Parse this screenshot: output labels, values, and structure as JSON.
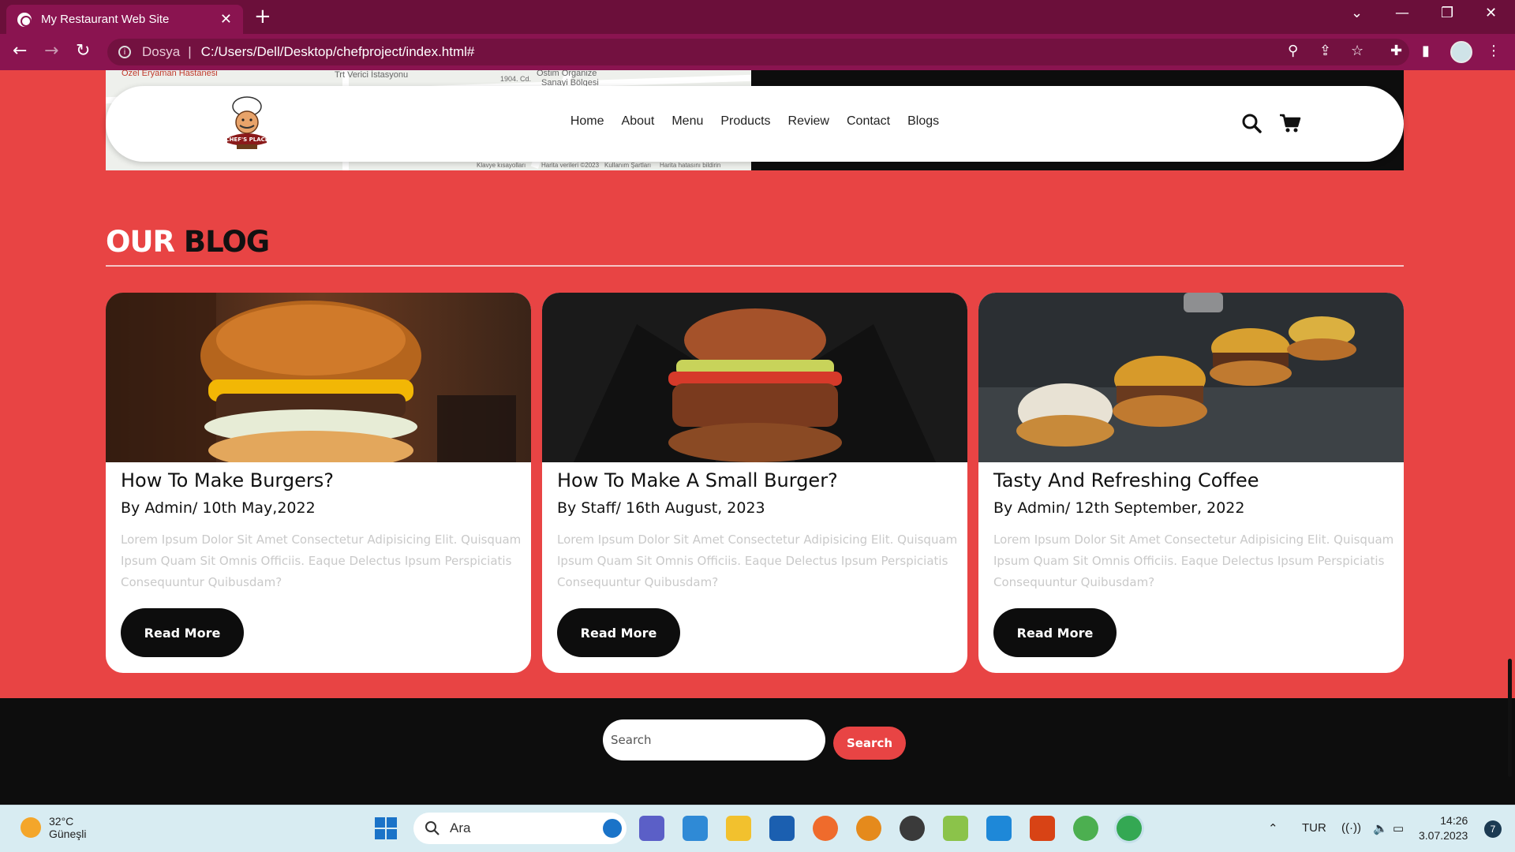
{
  "browser": {
    "tab_title": "My Restaurant Web Site",
    "tab_close": "✕",
    "new_tab": "+",
    "url_protocol": "Dosya",
    "url_separator": "|",
    "url": "C:/Users/Dell/Desktop/chefproject/index.html#",
    "info_icon": "i"
  },
  "map": {
    "labels": [
      "Özel Eryaman Hastanesi",
      "Trt Verici İstasyonu",
      "Ostim Organize",
      "Sanayi Bölgesi",
      "1904. Cd.",
      "Klavye kısayolları",
      "Harita verileri ©2023",
      "Kullanım Şartları",
      "Harita hatasını bildirin"
    ]
  },
  "header": {
    "nav": [
      "Home",
      "About",
      "Menu",
      "Products",
      "Review",
      "Contact",
      "Blogs"
    ],
    "logo_text": "CHEF'S PLACE"
  },
  "blog": {
    "title_white": "OUR",
    "title_black": "BLOG",
    "cards": [
      {
        "title": "How To Make Burgers?",
        "meta": "By Admin/ 10th May,2022",
        "desc": "Lorem Ipsum Dolor Sit Amet Consectetur Adipisicing Elit. Quisquam Ipsum Quam Sit Omnis Officiis. Eaque Delectus Ipsum Perspiciatis Consequuntur Quibusdam?",
        "button": "Read More"
      },
      {
        "title": "How To Make A Small Burger?",
        "meta": "By Staff/ 16th August, 2023",
        "desc": "Lorem Ipsum Dolor Sit Amet Consectetur Adipisicing Elit. Quisquam Ipsum Quam Sit Omnis Officiis. Eaque Delectus Ipsum Perspiciatis Consequuntur Quibusdam?",
        "button": "Read More"
      },
      {
        "title": "Tasty And Refreshing Coffee",
        "meta": "By Admin/ 12th September, 2022",
        "desc": "Lorem Ipsum Dolor Sit Amet Consectetur Adipisicing Elit. Quisquam Ipsum Quam Sit Omnis Officiis. Eaque Delectus Ipsum Perspiciatis Consequuntur Quibusdam?",
        "button": "Read More"
      }
    ]
  },
  "footer": {
    "search_placeholder": "Search",
    "search_button": "Search"
  },
  "taskbar": {
    "temperature": "32°C",
    "weather": "Güneşli",
    "search_placeholder": "Ara",
    "language": "TUR",
    "time": "14:26",
    "date": "3.07.2023",
    "notifications": "7"
  },
  "colors": {
    "accent": "#e84444",
    "tab_bar": "#6b0f3a",
    "address_bar": "#8a1450"
  }
}
